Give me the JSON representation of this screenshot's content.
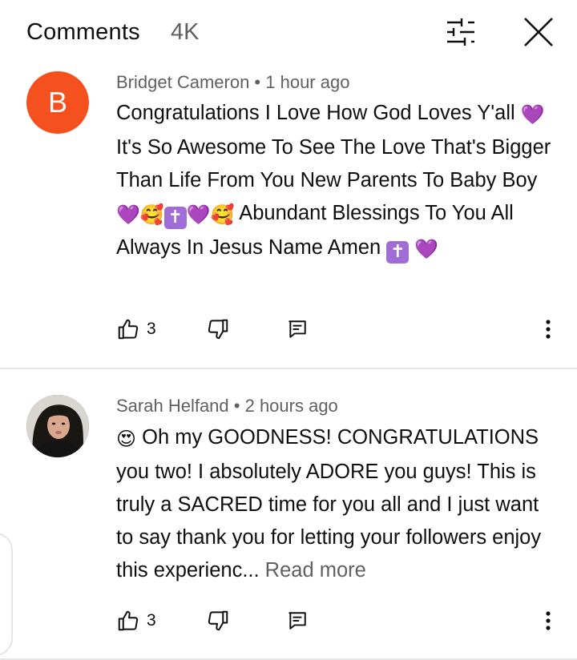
{
  "header": {
    "title": "Comments",
    "count": "4K",
    "filter_icon": "sliders-icon",
    "close_icon": "close-icon"
  },
  "comments": [
    {
      "author": "Bridget Cameron",
      "separator": " • ",
      "time": "1 hour ago",
      "avatar_letter": "B",
      "avatar_color": "#f4511e",
      "text": {
        "part1": "Congratulations I Love How God Loves Y'all ",
        "heart1": "💜",
        "part2": " It's So Awesome To See The Love That's Bigger Than Life From You New Parents To Baby Boy",
        "emoji_run_1": "💜🥰",
        "cross1": "✝",
        "emoji_run_2": "💜🥰",
        "part3": " Abundant Blessings To You All Always In Jesus Name Amen ",
        "cross2": "✝",
        "heart_end": "💜"
      },
      "likes": "3"
    },
    {
      "author": "Sarah Helfand",
      "separator": " • ",
      "time": "2 hours ago",
      "avatar_desc": "profile-photo",
      "text": {
        "emoji": "😍",
        "part1": " Oh my GOODNESS! CONGRATULATIONS you two! I absolutely ADORE you guys! This is truly a SACRED time for you all and I just want to say thank you for letting your followers enjoy this experienc...",
        "read_more": " Read more"
      },
      "likes": "3"
    }
  ],
  "colors": {
    "text_primary": "#0f0f0f",
    "text_secondary": "#606060",
    "divider": "#e5e5e5",
    "heart": "#8e24aa",
    "cross_bg": "#a06cd5"
  },
  "icons": {
    "like": "thumbs-up-icon",
    "dislike": "thumbs-down-icon",
    "reply": "reply-icon",
    "more": "more-vert-icon"
  }
}
